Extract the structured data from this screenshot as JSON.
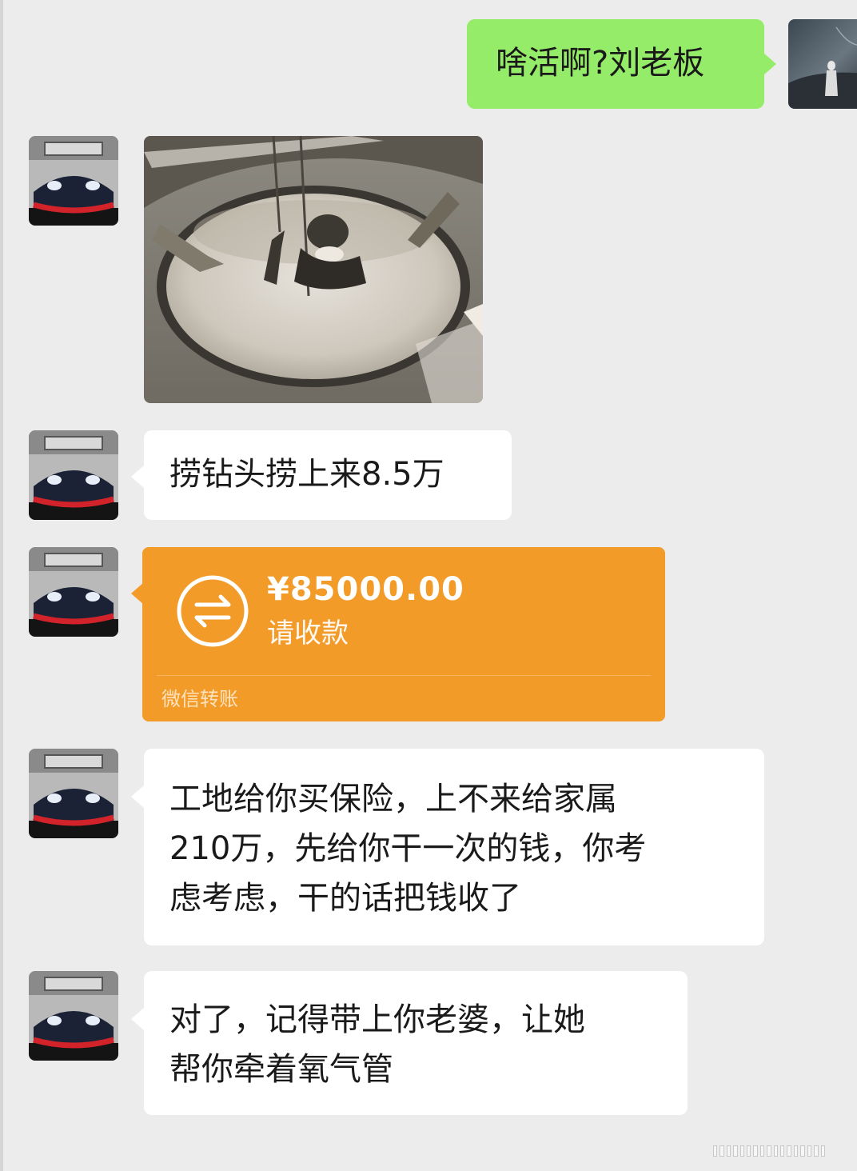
{
  "chat": {
    "messages": [
      {
        "type": "text",
        "direction": "out",
        "text": "啥活啊?刘老板"
      },
      {
        "type": "image",
        "direction": "in"
      },
      {
        "type": "text",
        "direction": "in",
        "text": "捞钻头捞上来8.5万"
      },
      {
        "type": "transfer",
        "direction": "in",
        "amount": "¥85000.00",
        "status": "请收款",
        "footer": "微信转账"
      },
      {
        "type": "text",
        "direction": "in",
        "lines": [
          "工地给你买保险，上不来给家属",
          "210万，先给你干一次的钱，你考",
          "虑考虑，干的话把钱收了"
        ]
      },
      {
        "type": "text",
        "direction": "in",
        "lines": [
          "对了，记得带上你老婆，让她",
          "帮你牵着氧气管"
        ]
      }
    ]
  },
  "colors": {
    "background": "#ececec",
    "outgoing_bubble": "#95ec69",
    "incoming_bubble": "#ffffff",
    "transfer_card": "#f39b28"
  },
  "icons": {
    "transfer": "transfer-arrows-icon"
  }
}
